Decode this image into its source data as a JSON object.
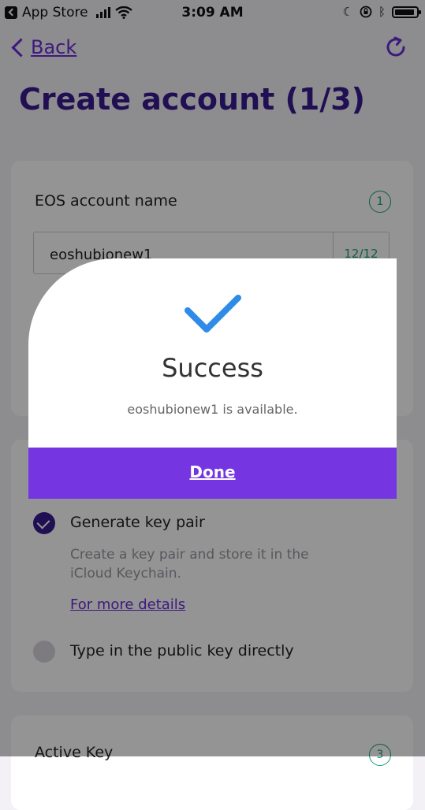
{
  "status_bar": {
    "app_label": "App Store",
    "time": "3:09 AM"
  },
  "nav": {
    "back_label": "Back"
  },
  "page_title": "Create account (1/3)",
  "account_card": {
    "label": "EOS account name",
    "step": "1",
    "input_value": "eoshubionew1",
    "char_count": "12/12"
  },
  "key_card": {
    "options": [
      {
        "label": "Generate key pair",
        "description": "Create a key pair and store it in the iCloud Keychain.",
        "link": "For more details",
        "checked": true
      },
      {
        "label": "Type in the public key directly",
        "checked": false
      }
    ]
  },
  "active_card": {
    "label": "Active Key",
    "step": "3"
  },
  "modal": {
    "title": "Success",
    "message": "eoshubionew1 is available.",
    "button_label": "Done"
  },
  "colors": {
    "primary": "#6c2bd9",
    "title": "#3a1a8f",
    "done_button": "#7536e2",
    "check_icon": "#2f8be8",
    "step_badge": "#18a07a"
  }
}
